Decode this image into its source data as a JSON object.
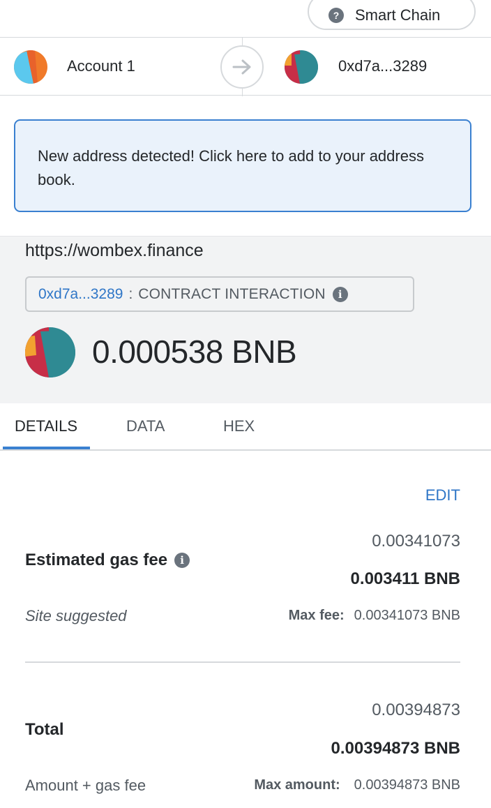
{
  "network": {
    "label": "Smart Chain",
    "help_glyph": "?"
  },
  "from_account": {
    "name": "Account 1"
  },
  "to_account": {
    "address": "0xd7a...3289"
  },
  "banner": {
    "text": "New address detected! Click here to add to your address book."
  },
  "summary": {
    "origin": "https://wombex.finance",
    "method_address": "0xd7a...3289",
    "method_separator": ":",
    "method_label": "CONTRACT INTERACTION",
    "value": "0.000538 BNB"
  },
  "tabs": [
    {
      "label": "DETAILS",
      "active": true
    },
    {
      "label": "DATA",
      "active": false
    },
    {
      "label": "HEX",
      "active": false
    }
  ],
  "details": {
    "edit_label": "EDIT",
    "gas": {
      "label": "Estimated gas fee",
      "secondary": "0.00341073",
      "primary": "0.003411 BNB",
      "source": "Site suggested",
      "max_fee_label": "Max fee:",
      "max_fee_value": "0.00341073 BNB"
    },
    "total": {
      "label": "Total",
      "secondary": "0.00394873",
      "primary": "0.00394873 BNB",
      "subtitle": "Amount + gas fee",
      "max_amount_label": "Max amount:",
      "max_amount_value": "0.00394873 BNB"
    }
  },
  "colors": {
    "accent": "#3a80d0",
    "link": "#2f76c7",
    "banner_bg": "#eaf2fb",
    "summary_bg": "#f2f3f4"
  }
}
